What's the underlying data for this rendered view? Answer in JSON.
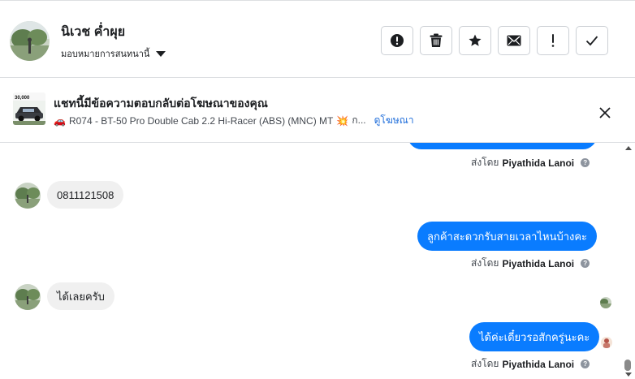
{
  "conversation": {
    "contact_name": "นิเวช ค่ำผุย",
    "assign_label": "มอบหมายการสนทนานี้"
  },
  "actions": [
    {
      "name": "mark-spam-button",
      "icon": "alert-circle-icon"
    },
    {
      "name": "delete-button",
      "icon": "trash-icon"
    },
    {
      "name": "star-button",
      "icon": "star-icon"
    },
    {
      "name": "mark-unread-button",
      "icon": "envelope-icon"
    },
    {
      "name": "follow-up-button",
      "icon": "exclamation-icon"
    },
    {
      "name": "mark-done-button",
      "icon": "checkmark-icon"
    }
  ],
  "ad": {
    "thumb_price": "30,000",
    "title": "แชทนี้มีข้อความตอบกลับต่อโฆษณาของคุณ",
    "car_emoji": "🚗",
    "description": "R074 - BT-50 Pro Double Cab 2.2 Hi-Racer (ABS) (MNC) MT",
    "burst_emoji": "💥",
    "description_trail": "ก...",
    "view_ad_link": "ดูโฆษณา"
  },
  "messages": {
    "sent_by_prefix": "ส่งโดย",
    "agent_name": "Piyathida Lanoi",
    "incoming_1": "0811121508",
    "outgoing_1": "ลูกค้าสะดวกรับสายเวลาไหนบ้างคะ",
    "incoming_2": "ได้เลยครับ",
    "outgoing_2": "ได้ค่ะเดี๋ยวรอสักครู่นะคะ"
  },
  "colors": {
    "outgoing_bubble": "#0a7cff",
    "incoming_bubble": "#f0f0f0",
    "link": "#216fdb"
  }
}
